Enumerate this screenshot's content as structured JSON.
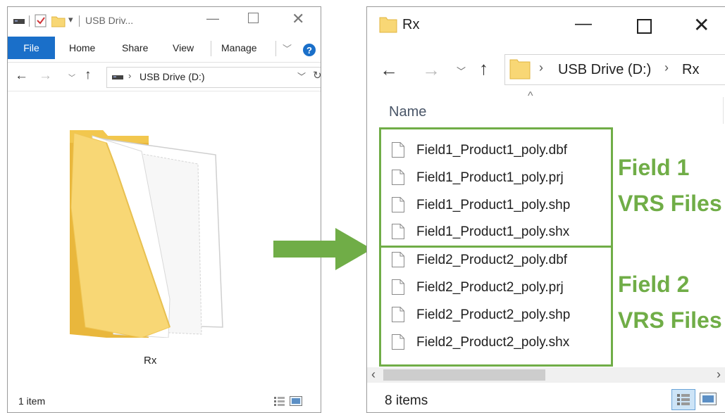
{
  "left_window": {
    "title": "USB Driv...",
    "ribbon_tabs": [
      "File",
      "Home",
      "Share",
      "View",
      "Manage"
    ],
    "address": {
      "path": "USB Drive (D:)"
    },
    "folder_label": "Rx",
    "status_count": "1 item"
  },
  "right_window": {
    "title": "Rx",
    "address": {
      "drive": "USB Drive (D:)",
      "folder": "Rx"
    },
    "column_header": "Name",
    "files": [
      "Field1_Product1_poly.dbf",
      "Field1_Product1_poly.prj",
      "Field1_Product1_poly.shp",
      "Field1_Product1_poly.shx",
      "Field2_Product2_poly.dbf",
      "Field2_Product2_poly.prj",
      "Field2_Product2_poly.shp",
      "Field2_Product2_poly.shx"
    ],
    "groups": [
      {
        "line1": "Field 1",
        "line2": "VRS Files"
      },
      {
        "line1": "Field 2",
        "line2": "VRS Files"
      }
    ],
    "status_count": "8 items"
  },
  "colors": {
    "annotation_green": "#70ad47",
    "ribbon_blue": "#1a6fc9",
    "folder_yellow": "#f8d775"
  }
}
